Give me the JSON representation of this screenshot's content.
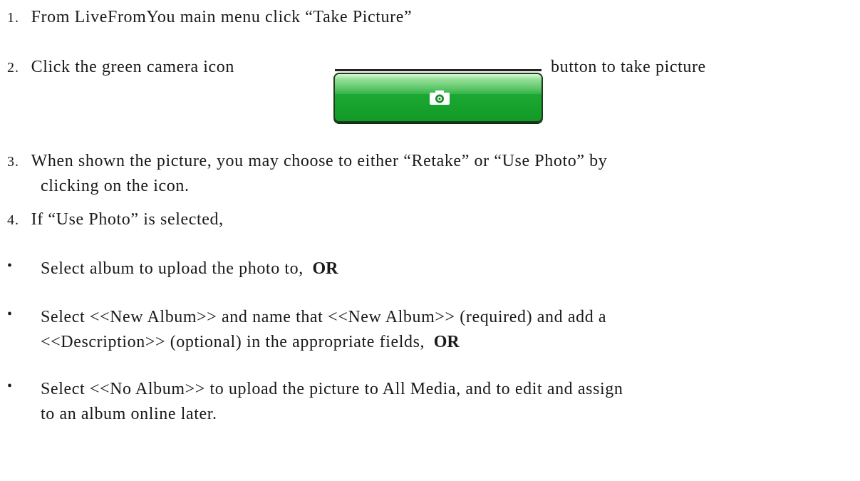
{
  "steps": [
    {
      "num": "1.",
      "text": "From LiveFromYou main menu click “Take Picture”"
    },
    {
      "num": "2.",
      "text_before": "Click the green camera icon",
      "text_after": "button to take picture"
    },
    {
      "num": "3.",
      "line1": "When shown the picture, you may choose to either “Retake” or “Use Photo” by",
      "line2": "clicking on the icon."
    },
    {
      "num": "4.",
      "text": "If “Use Photo” is selected,"
    }
  ],
  "bullets": [
    {
      "mark": "•",
      "text": "Select album to upload the photo to,",
      "strong": "OR"
    },
    {
      "mark": "•",
      "line1": "Select <<New Album>> and name that <<New Album>> (required) and add a",
      "line2": "<<Description>> (optional) in the appropriate fields,",
      "strong": "OR"
    },
    {
      "mark": "•",
      "line1": "Select <<No Album>> to upload the picture to All Media, and to edit and assign",
      "line2": "to an album online later."
    }
  ],
  "camera_button": {
    "icon": "camera-icon",
    "color": "#1ba832"
  }
}
